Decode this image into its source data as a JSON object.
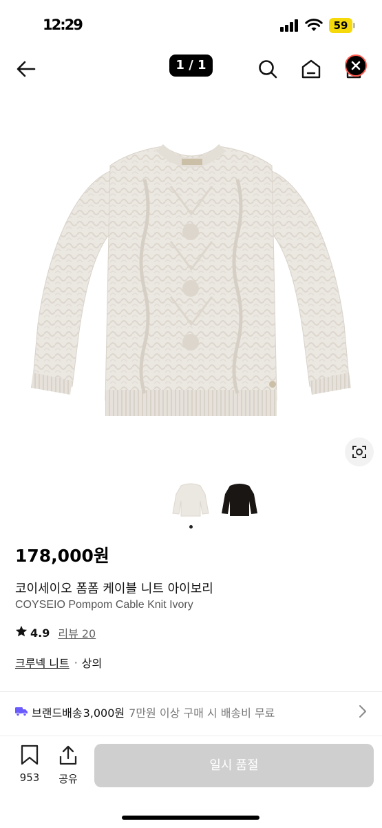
{
  "status_bar": {
    "time": "12:29",
    "battery": "59"
  },
  "nav": {
    "page_counter": "1 / 1",
    "icons": [
      "back-arrow-icon",
      "search-icon",
      "home-icon",
      "cart-icon",
      "close-icon"
    ]
  },
  "product": {
    "price": "178,000원",
    "name_ko": "코이세이오 폼폼 케이블 니트 아이보리",
    "name_en": "COYSEIO Pompom Cable Knit Ivory",
    "label_text": "COYSEIO",
    "rating": "4.9",
    "review_label": "리뷰 20",
    "categories": {
      "primary": "크루넥 니트",
      "separator": "·",
      "secondary": "상의"
    },
    "thumbnails": [
      "ivory",
      "black"
    ],
    "colors": {
      "sweater_ivory": "#ebe7e1",
      "sweater_black": "#1a1614"
    }
  },
  "shipping": {
    "label": "브랜드배송",
    "fee": "3,000원",
    "note": "7만원 이상 구매 시 배송비 무료",
    "icon": "truck-icon",
    "icon_color": "#6a5bff"
  },
  "bottom": {
    "like_count": "953",
    "share_label": "공유",
    "button_label": "일시 품절",
    "button_color": "#cfcfcf"
  }
}
